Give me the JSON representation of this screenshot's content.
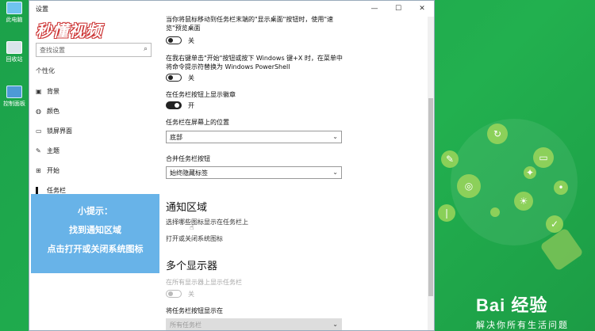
{
  "desktop": {
    "icons": [
      {
        "label": "此电脑"
      },
      {
        "label": "回收站"
      },
      {
        "label": "控制面板"
      }
    ],
    "brand": "Bai 经验",
    "brand_sub": "解决你所有生活问题"
  },
  "window": {
    "title": "设置",
    "controls": {
      "minimize": "—",
      "maximize": "☐",
      "close": "✕"
    },
    "watermark": "秒懂视频"
  },
  "sidebar": {
    "search_placeholder": "查找设置",
    "header": "个性化",
    "items": [
      {
        "label": "背景",
        "icon": "picture-icon"
      },
      {
        "label": "颜色",
        "icon": "palette-icon"
      },
      {
        "label": "锁屏界面",
        "icon": "lockscreen-icon"
      },
      {
        "label": "主题",
        "icon": "brush-icon"
      },
      {
        "label": "开始",
        "icon": "start-icon"
      },
      {
        "label": "任务栏",
        "icon": "taskbar-icon",
        "active": true
      }
    ]
  },
  "tip": {
    "line1": "小提示：",
    "line2": "找到通知区域",
    "line3": "点击打开或关闭系统图标"
  },
  "content": {
    "peek_desc": "当你将鼠标移动到任务栏末端的\"显示桌面\"按钮时，使用\"速览\"预览桌面",
    "peek_state": "关",
    "powershell_desc": "在我右键单击\"开始\"按钮或按下 Windows 键+X 时，在菜单中将命令提示符替换为 Windows PowerShell",
    "powershell_state": "关",
    "badge_desc": "在任务栏按钮上显示徽章",
    "badge_state": "开",
    "position_label": "任务栏在屏幕上的位置",
    "position_value": "底部",
    "combine_label": "合并任务栏按钮",
    "combine_value": "始终隐藏标签",
    "notify_title": "通知区域",
    "notify_link1": "选择哪些图标显示在任务栏上",
    "notify_link2": "打开或关闭系统图标",
    "multi_title": "多个显示器",
    "multi_desc": "在所有显示器上显示任务栏",
    "multi_state": "关",
    "multi_show_label": "将任务栏按钮显示在",
    "multi_show_value": "所有任务栏"
  },
  "colors": {
    "desktop_bg": "#1ea84a",
    "tip_bg": "#68b3e8",
    "accent": "#222222"
  }
}
